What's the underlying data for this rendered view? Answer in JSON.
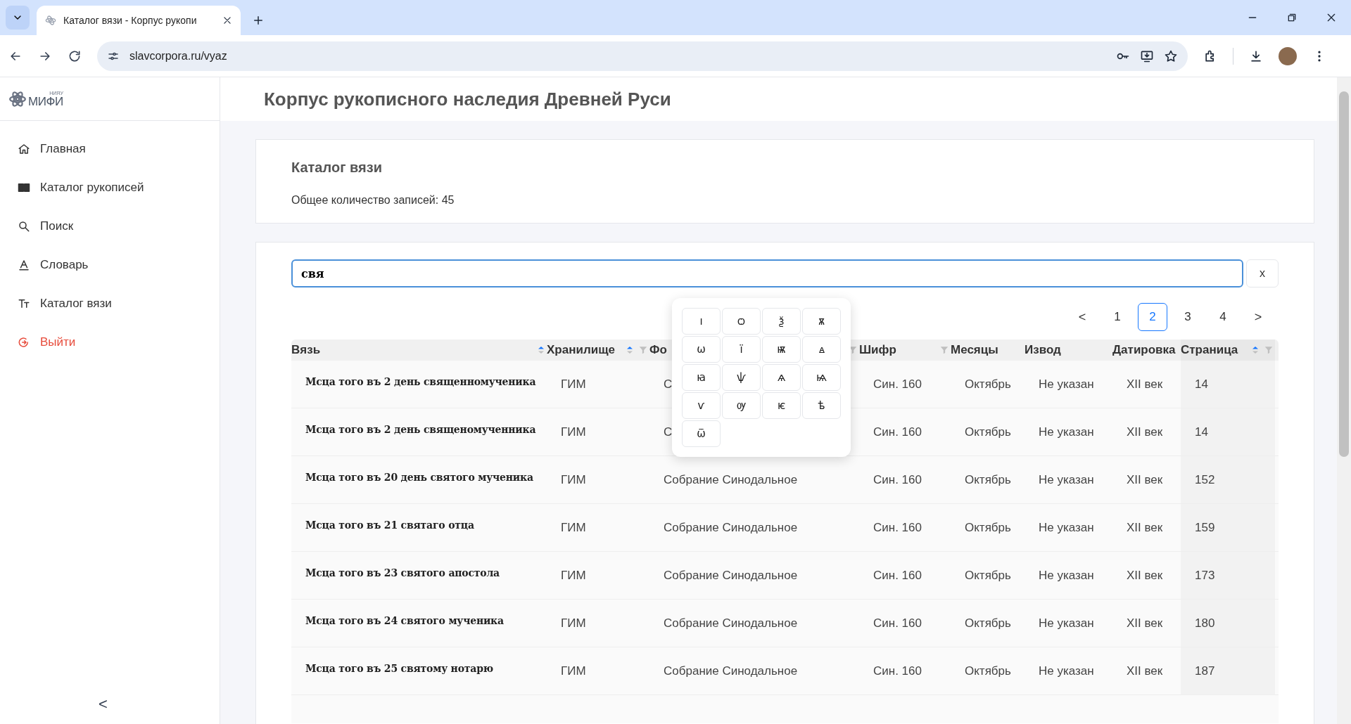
{
  "browser": {
    "tab_title": "Каталог вязи - Корпус рукопи",
    "url": "slavcorpora.ru/vyaz"
  },
  "sidebar": {
    "logo": {
      "small": "НИЯУ",
      "big": "МИФИ"
    },
    "items": [
      {
        "label": "Главная",
        "kind": "link"
      },
      {
        "label": "Каталог рукописей",
        "kind": "link"
      },
      {
        "label": "Поиск",
        "kind": "link"
      },
      {
        "label": "Словарь",
        "kind": "link"
      },
      {
        "label": "Каталог вязи",
        "kind": "link"
      },
      {
        "label": "Выйти",
        "kind": "logout"
      }
    ],
    "collapse": "<"
  },
  "header": {
    "title": "Корпус рукописного наследия Древней Руси"
  },
  "summary": {
    "title": "Каталог вязи",
    "count": "Общее количество записей: 45"
  },
  "search": {
    "value": "свя",
    "clear": "x"
  },
  "keyboard": [
    "ı",
    "ѻ",
    "ѯ",
    "ѫ",
    "ѡ",
    "ї",
    "ѭ",
    "ꙙ",
    "ꙗ",
    "ѱ",
    "ѧ",
    "ѩ",
    "ѵ",
    "ѹ",
    "ѥ",
    "ѣ",
    "ѿ"
  ],
  "pagination": {
    "prev": "<",
    "next": ">",
    "pages": [
      {
        "label": "1",
        "selected": false
      },
      {
        "label": "2",
        "selected": true
      },
      {
        "label": "3",
        "selected": false
      },
      {
        "label": "4",
        "selected": false
      }
    ]
  },
  "table": {
    "columns": [
      {
        "label": "Вязь",
        "sortable": true,
        "filter": false
      },
      {
        "label": "Хранилище",
        "sortable": true,
        "filter": true
      },
      {
        "label": "Фо",
        "sortable": false,
        "filter": true
      },
      {
        "label": "Шифр",
        "sortable": false,
        "filter": true
      },
      {
        "label": "Месяцы",
        "sortable": false,
        "filter": false
      },
      {
        "label": "Извод",
        "sortable": false,
        "filter": false
      },
      {
        "label": "Датировка",
        "sortable": false,
        "filter": false
      },
      {
        "label": "Страница",
        "sortable": true,
        "filter": true
      }
    ],
    "rows": [
      [
        "Мсца того въ 2 день священномученика",
        "ГИМ",
        "С",
        "Син. 160",
        "Октябрь",
        "Не указан",
        "XII век",
        "14"
      ],
      [
        "Мсца того въ 2 день священомученника",
        "ГИМ",
        "С",
        "Син. 160",
        "Октябрь",
        "Не указан",
        "XII век",
        "14"
      ],
      [
        "Мсца того въ 20 день святого мученика",
        "ГИМ",
        "Собрание Синодальное",
        "Син. 160",
        "Октябрь",
        "Не указан",
        "XII век",
        "152"
      ],
      [
        "Мсца того въ 21 святаго отца",
        "ГИМ",
        "Собрание Синодальное",
        "Син. 160",
        "Октябрь",
        "Не указан",
        "XII век",
        "159"
      ],
      [
        "Мсца того въ 23 святого апостола",
        "ГИМ",
        "Собрание Синодальное",
        "Син. 160",
        "Октябрь",
        "Не указан",
        "XII век",
        "173"
      ],
      [
        "Мсца того въ 24 святого мученика",
        "ГИМ",
        "Собрание Синодальное",
        "Син. 160",
        "Октябрь",
        "Не указан",
        "XII век",
        "180"
      ],
      [
        "Мсца того въ 25 святому нотарю",
        "ГИМ",
        "Собрание Синодальное",
        "Син. 160",
        "Октябрь",
        "Не указан",
        "XII век",
        "187"
      ]
    ]
  }
}
